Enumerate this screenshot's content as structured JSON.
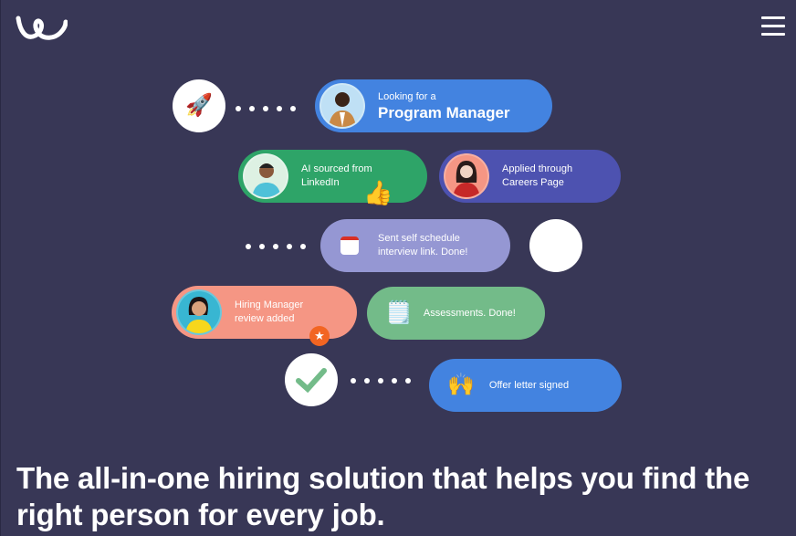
{
  "header": {
    "logo_icon": "workable-w-logo",
    "menu_icon": "hamburger-menu-icon"
  },
  "flow": {
    "start_icon": "rocket-emoji",
    "start_glyph": "🚀",
    "steps": [
      {
        "line1": "Looking for a",
        "line2": "Program Manager",
        "color": "#4383E0",
        "icon": "avatar-man-blazer"
      },
      {
        "line1": "AI sourced from",
        "line2": "LinkedIn",
        "color": "#2EA468",
        "icon": "avatar-man-beard",
        "badge": "👍"
      },
      {
        "line1": "Applied through",
        "line2": "Careers Page",
        "color": "#4D52B0",
        "icon": "avatar-woman-red-top"
      },
      {
        "line1": "Sent self schedule",
        "line2": "interview link. Done!",
        "color": "#9597D3",
        "icon": "calendar-icon"
      },
      {
        "line1": "Hiring Manager",
        "line2": "review added",
        "color": "#F59684",
        "icon": "avatar-woman-yellow-shirt",
        "badge": "★"
      },
      {
        "line1": "Assessments. Done!",
        "line2": "",
        "color": "#73BB89",
        "icon": "notepad-icon",
        "glyph": "🗒️"
      },
      {
        "line1": "Offer letter signed",
        "line2": "",
        "color": "#4383E0",
        "icon": "raised-hands-emoji",
        "glyph": "🙌"
      }
    ],
    "end_icon": "checkmark-icon"
  },
  "headline": "The all-in-one hiring solution that helps you find the right person for every job.",
  "colors": {
    "background": "#383756",
    "check_green": "#73BB89",
    "star_badge": "#F26522"
  }
}
